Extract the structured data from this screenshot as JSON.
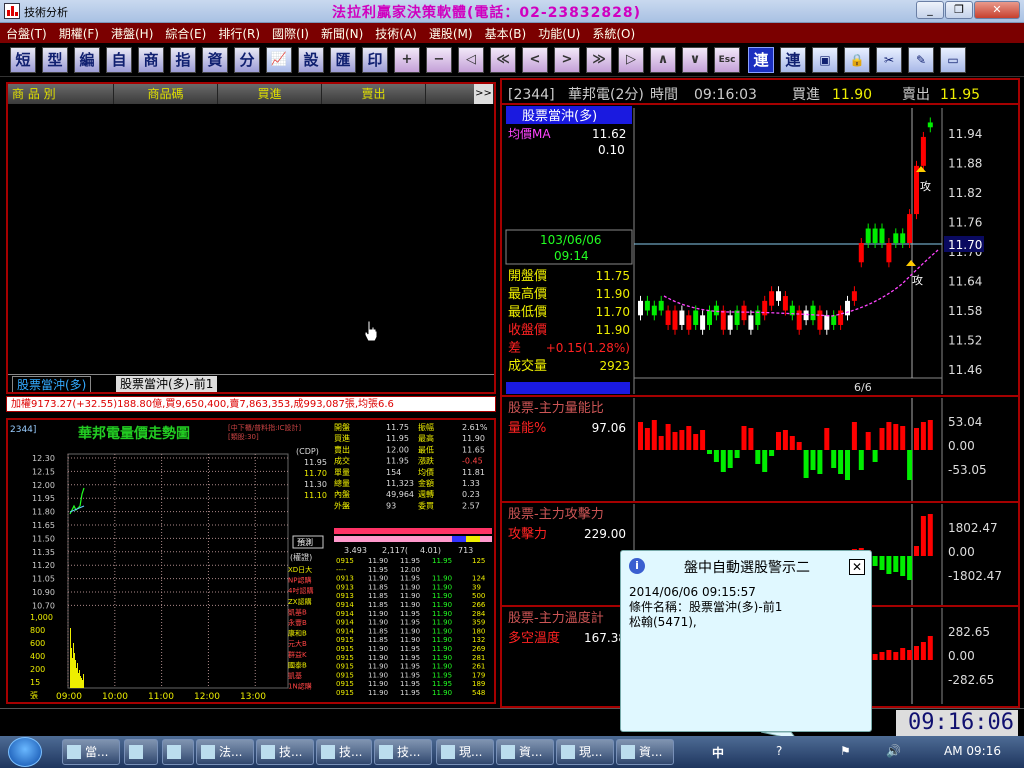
{
  "window": {
    "title_left": "技術分析",
    "title_center": "法拉利贏家決策軟體(電話：02-23832828)",
    "controls": {
      "minimize": "_",
      "restore": "❐",
      "close": "✕"
    }
  },
  "menu": [
    "台盤(T)",
    "期權(F)",
    "港盤(H)",
    "綜合(E)",
    "排行(R)",
    "國際(I)",
    "新聞(N)",
    "技術(A)",
    "選股(M)",
    "基本(B)",
    "功能(U)",
    "系統(O)"
  ],
  "toolbar": {
    "text_buttons": [
      "短",
      "型",
      "編",
      "自",
      "商",
      "指",
      "資",
      "分"
    ],
    "text_buttons2": [
      "設",
      "匯",
      "印"
    ],
    "sym_buttons": [
      "+",
      "−",
      "◁",
      "≪",
      "<",
      ">",
      "≫",
      "▷",
      "∧",
      "∨"
    ],
    "esc_label": "Esc",
    "tail_buttons": [
      "連",
      "連"
    ]
  },
  "left_table": {
    "headers": [
      "商 品 別",
      "商品碼",
      "買進",
      "賣出"
    ],
    "scroll_btn": ">>",
    "tabs": [
      "股票當沖(多)",
      "股票當沖(多)-前1"
    ]
  },
  "index_line": "加權9173.27(+32.55)188.80億,買9,650,400,賣7,863,353,成993,087張,均張6.6",
  "intraday": {
    "code": "2344]",
    "title": "華邦電量價走勢圖",
    "subtitle": "[中下櫃/普料指:IC設計]\n[類股:30]",
    "price_axis": [
      "12.30",
      "12.15",
      "12.00",
      "11.95",
      "11.80",
      "11.65",
      "11.50",
      "11.35",
      "11.20",
      "11.05",
      "10.90",
      "10.70"
    ],
    "volume_axis": [
      "1,000",
      "800",
      "600",
      "400",
      "200",
      "15",
      "張"
    ],
    "times": [
      "09:00",
      "10:00",
      "11:00",
      "12:00",
      "13:00"
    ],
    "cdp": {
      "label": "(CDP)",
      "values": [
        "11.95",
        "11.70",
        "11.30",
        "11.10"
      ]
    },
    "predict_btn": "預測",
    "ranking_label": "(權證)",
    "rank_labels": [
      "XD日大",
      "NP認購",
      "4吋認購",
      "ZX認購",
      "凱基B",
      "永豐B",
      "康和B",
      "元大B",
      "群益K",
      "國泰B",
      "凱基",
      "1N認購"
    ],
    "quote_rows": [
      [
        "開盤",
        "11.75",
        "振幅",
        "2.61%"
      ],
      [
        "買進",
        "11.95",
        "最高",
        "11.90"
      ],
      [
        "賣出",
        "12.00",
        "最低",
        "11.65"
      ],
      [
        "成交",
        "11.95",
        "漲跌",
        "-0.45"
      ],
      [
        "單量",
        "154",
        "均價",
        "11.81"
      ],
      [
        "總量",
        "11,323",
        "金額",
        "1.33"
      ],
      [
        "內盤",
        "49,964",
        "週轉",
        "0.23"
      ],
      [
        "外盤",
        "93",
        "委買",
        "2.57"
      ]
    ],
    "depth_summary": [
      "3.493",
      "2,117(",
      "4.01)",
      "713"
    ],
    "ticks": [
      [
        "0915",
        "11.90",
        "11.95",
        "11.95",
        "125"
      ],
      [
        "----",
        "11.95",
        "12.00",
        "",
        ""
      ],
      [
        "0913",
        "11.90",
        "11.95",
        "11.90",
        "124"
      ],
      [
        "0913",
        "11.85",
        "11.90",
        "11.90",
        "39"
      ],
      [
        "0913",
        "11.85",
        "11.90",
        "11.90",
        "500"
      ],
      [
        "0914",
        "11.85",
        "11.90",
        "11.90",
        "266"
      ],
      [
        "0914",
        "11.90",
        "11.95",
        "11.90",
        "284"
      ],
      [
        "0914",
        "11.90",
        "11.95",
        "11.90",
        "359"
      ],
      [
        "0914",
        "11.85",
        "11.90",
        "11.90",
        "180"
      ],
      [
        "0915",
        "11.85",
        "11.90",
        "11.90",
        "132"
      ],
      [
        "0915",
        "11.90",
        "11.95",
        "11.90",
        "269"
      ],
      [
        "0915",
        "11.90",
        "11.95",
        "11.90",
        "281"
      ],
      [
        "0915",
        "11.90",
        "11.95",
        "11.90",
        "261"
      ],
      [
        "0915",
        "11.90",
        "11.95",
        "11.95",
        "179"
      ],
      [
        "0915",
        "11.90",
        "11.95",
        "11.95",
        "189"
      ],
      [
        "0915",
        "11.90",
        "11.95",
        "11.90",
        "548"
      ]
    ]
  },
  "right": {
    "header": {
      "code": "[2344]",
      "name": "華邦電(2分)",
      "mode": "時間",
      "time": "09:16:03",
      "bid_label": "買進",
      "bid": "11.90",
      "ask_label": "賣出",
      "ask": "11.95"
    },
    "strategy_tab": "股票當沖(多)",
    "ma_label": "均價MA",
    "ma_value": "11.62",
    "ma_value2": "0.10",
    "date": "103/06/06",
    "time": "09:14",
    "ohlc": [
      {
        "label": "開盤價",
        "value": "11.75"
      },
      {
        "label": "最高價",
        "value": "11.90"
      },
      {
        "label": "最低價",
        "value": "11.70"
      },
      {
        "label": "收盤價",
        "value": "11.90"
      },
      {
        "label": "差",
        "value": "+0.15(1.28%)"
      },
      {
        "label": "成交量",
        "value": "2923"
      }
    ],
    "price_axis": [
      "11.94",
      "11.88",
      "11.82",
      "11.76",
      "11.70",
      "11.64",
      "11.58",
      "11.52",
      "11.46"
    ],
    "current_price": "11.70",
    "page_indicator": "6/6",
    "marker_labels": [
      "攻",
      "攻"
    ],
    "indicators": [
      {
        "title": "股票-主力量能比",
        "label": "量能%",
        "value": "97.06",
        "axis": [
          "53.04",
          "0.00",
          "-53.05"
        ]
      },
      {
        "title": "股票-主力攻擊力",
        "label": "攻擊力",
        "value": "229.00",
        "axis": [
          "1802.47",
          "0.00",
          "-1802.47"
        ]
      },
      {
        "title": "股票-主力溫度計",
        "label": "多空溫度",
        "value": "167.38",
        "axis": [
          "282.65",
          "0.00",
          "-282.65"
        ]
      }
    ],
    "colors": {
      "up": "#ff0000",
      "down": "#00ee00",
      "frame": "#a60000",
      "ma": "#ff44ff"
    }
  },
  "popup": {
    "title": "盤中自動選股警示二",
    "icon": "info-icon",
    "body": "2014/06/06 09:15:57\n條件名稱：股票當沖(多)-前1\n松翰(5471),"
  },
  "clock": "09:16:06",
  "taskbar": {
    "items": [
      "當...",
      "",
      "",
      "法...",
      "技...",
      "技...",
      "技...",
      "現...",
      "資...",
      "現...",
      "資..."
    ],
    "tray_time": "AM 09:16",
    "ime": "中"
  }
}
